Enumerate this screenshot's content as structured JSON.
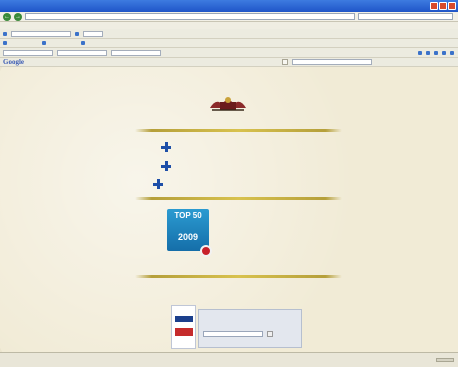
{
  "window": {
    "title": "",
    "accent": "#1f55c8"
  },
  "nav": {
    "address": "",
    "search_placeholder": ""
  },
  "menu": {
    "items": [
      "",
      "",
      "",
      "",
      "",
      ""
    ]
  },
  "toolbar": {
    "google_logo": "Google",
    "go_label": ""
  },
  "page": {
    "links": [
      {
        "text": "",
        "color": "#d13ad1"
      },
      {
        "text": "",
        "color": "#2a3fd4"
      },
      {
        "text": "",
        "color": "#d13ad1"
      }
    ],
    "award": {
      "top_text": "TOP 50",
      "year": "2009",
      "link_text": "",
      "link_color": "#2a3fd4"
    },
    "side_text": [
      "",
      ""
    ],
    "widget": {
      "title": "",
      "tabs": [
        "",
        "",
        "",
        "",
        ""
      ],
      "button": "",
      "radio": ""
    }
  },
  "status": {
    "left": "",
    "zone": ""
  }
}
